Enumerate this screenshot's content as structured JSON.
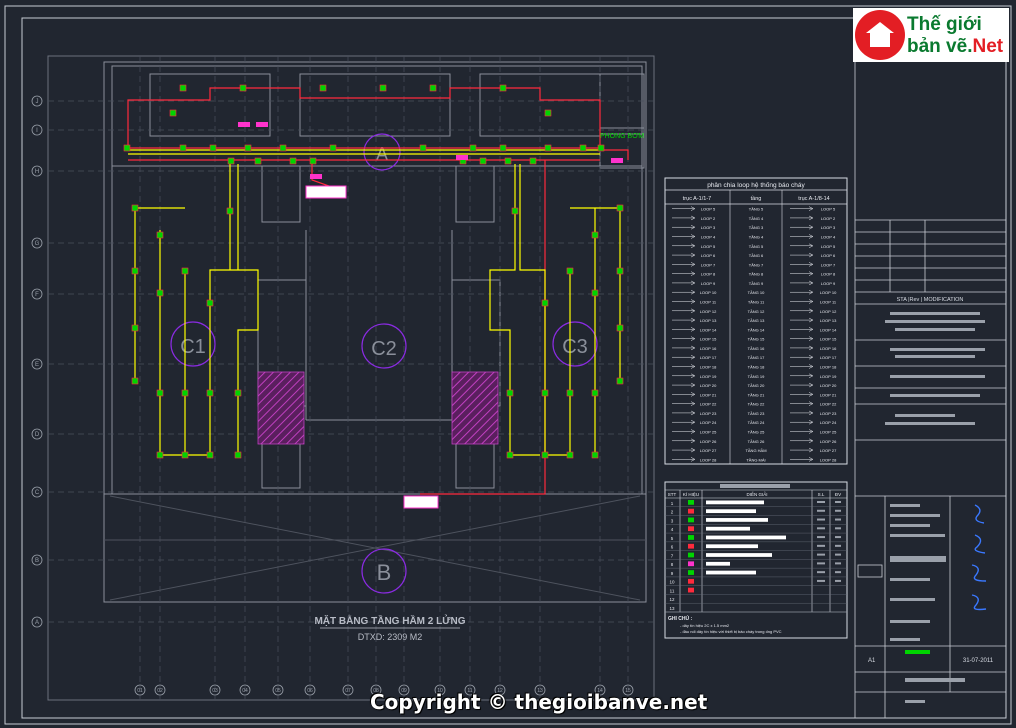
{
  "logo": {
    "line1": "Thế giới",
    "line2a": "bản vẽ.",
    "line2b": "Net"
  },
  "copyright": "Copyright © thegioibanve.net",
  "zones": [
    "A",
    "C1",
    "C2",
    "C3",
    "B"
  ],
  "drawing_title": {
    "line1": "MẶT BẰNG TẦNG HẦM 2 LỬNG",
    "line2": "DTXD: 2309 M2"
  },
  "room_label": "PHONG BƠM",
  "grid_left": [
    "J",
    "I",
    "H",
    "G",
    "F",
    "E",
    "D",
    "C",
    "B",
    "A"
  ],
  "grid_bottom": [
    "01",
    "02",
    "03",
    "04",
    "05",
    "06",
    "07",
    "08",
    "09",
    "10",
    "11",
    "12",
    "13",
    "14",
    "15"
  ],
  "zone_table": {
    "title": "phân chia loop hệ thống báo cháy",
    "headers": [
      "trục A-1/1-7",
      "tầng",
      "trục A-1/8-14"
    ],
    "rows": [
      [
        "LOOP 5",
        "TẦNG 5",
        "LOOP 5"
      ],
      [
        "LOOP 2",
        "TẦNG 4",
        "LOOP 2"
      ],
      [
        "LOOP 3",
        "TẦNG 3",
        "LOOP 3"
      ],
      [
        "LOOP 4",
        "TẦNG 4",
        "LOOP 4"
      ],
      [
        "LOOP 5",
        "TẦNG 5",
        "LOOP 5"
      ],
      [
        "LOOP 6",
        "TẦNG 6",
        "LOOP 6"
      ],
      [
        "LOOP 7",
        "TẦNG 7",
        "LOOP 7"
      ],
      [
        "LOOP 8",
        "TẦNG 8",
        "LOOP 8"
      ],
      [
        "LOOP 9",
        "TẦNG 9",
        "LOOP 9"
      ],
      [
        "LOOP 10",
        "TẦNG 10",
        "LOOP 10"
      ],
      [
        "LOOP 11",
        "TẦNG 11",
        "LOOP 11"
      ],
      [
        "LOOP 12",
        "TẦNG 12",
        "LOOP 12"
      ],
      [
        "LOOP 13",
        "TẦNG 13",
        "LOOP 13"
      ],
      [
        "LOOP 14",
        "TẦNG 14",
        "LOOP 14"
      ],
      [
        "LOOP 15",
        "TẦNG 15",
        "LOOP 15"
      ],
      [
        "LOOP 16",
        "TẦNG 16",
        "LOOP 16"
      ],
      [
        "LOOP 17",
        "TẦNG 17",
        "LOOP 17"
      ],
      [
        "LOOP 18",
        "TẦNG 18",
        "LOOP 18"
      ],
      [
        "LOOP 19",
        "TẦNG 19",
        "LOOP 19"
      ],
      [
        "LOOP 20",
        "TẦNG 20",
        "LOOP 20"
      ],
      [
        "LOOP 21",
        "TẦNG 21",
        "LOOP 21"
      ],
      [
        "LOOP 22",
        "TẦNG 22",
        "LOOP 22"
      ],
      [
        "LOOP 23",
        "TẦNG 23",
        "LOOP 23"
      ],
      [
        "LOOP 24",
        "TẦNG 24",
        "LOOP 24"
      ],
      [
        "LOOP 25",
        "TẦNG 25",
        "LOOP 25"
      ],
      [
        "LOOP 26",
        "TẦNG 26",
        "LOOP 26"
      ],
      [
        "LOOP 27",
        "TẦNG HẦM",
        "LOOP 27"
      ],
      [
        "LOOP 28",
        "TẦNG MÁI",
        "LOOP 28"
      ]
    ]
  },
  "legend_table": {
    "headers": [
      "STT",
      "KÍ HIỆU",
      "DIỄN GIẢI",
      "S.L",
      "ĐV"
    ],
    "rows": [
      "1",
      "2",
      "3",
      "4",
      "5",
      "6",
      "7",
      "8",
      "9",
      "10",
      "11",
      "12",
      "13"
    ],
    "note_label": "GHI CHÚ :",
    "notes": [
      "- dây tín hiệu 2C x 1.5 mm2",
      "- đầu nối dây tín hiệu với thiết bị báo cháy trong ống PVC"
    ]
  },
  "title_block": {
    "revision_header": "STA  |Rev  |  MODIFICATION",
    "scale": "A1",
    "date": "31-07-2011"
  },
  "colors": {
    "background": "#212630",
    "frame": "#c8ccd4",
    "structure": "#8a8f9a",
    "main_cable": "#ff2a3c",
    "loop_cable": "#ffff00",
    "device": "#00d400",
    "tag": "#ff33cc",
    "zone_circle": "#8a2be2",
    "stair_hatch": "#b030b0"
  }
}
